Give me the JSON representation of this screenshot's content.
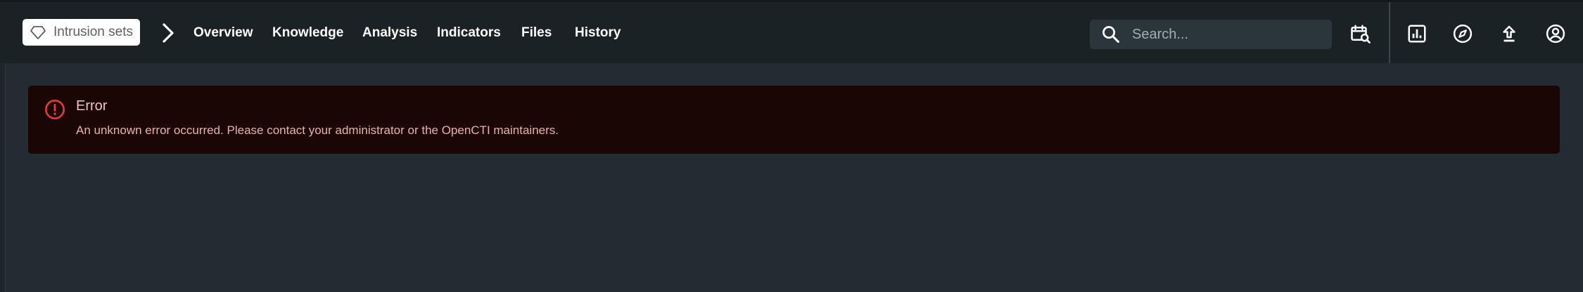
{
  "header": {
    "entity_chip_label": "Intrusion sets",
    "nav": [
      "Overview",
      "Knowledge",
      "Analysis",
      "Indicators",
      "Files",
      "History"
    ]
  },
  "search": {
    "placeholder": "Search..."
  },
  "icons": {
    "entity": "diamond-icon",
    "breadcrumb": "chevron-right-icon",
    "search": "search-icon",
    "calendar_search": "calendar-search-icon",
    "dashboard": "chart-box-icon",
    "explore": "compass-icon",
    "import": "upload-icon",
    "profile": "account-circle-icon",
    "error": "error-outline-icon"
  },
  "alert": {
    "title": "Error",
    "message": "An unknown error occurred. Please contact your administrator or the OpenCTI maintainers."
  },
  "colors": {
    "topbar": "#1b2226",
    "background": "#242c33",
    "alert_bg": "#1b0606",
    "alert_icon": "#e53935",
    "alert_text": "#eab0ab"
  }
}
